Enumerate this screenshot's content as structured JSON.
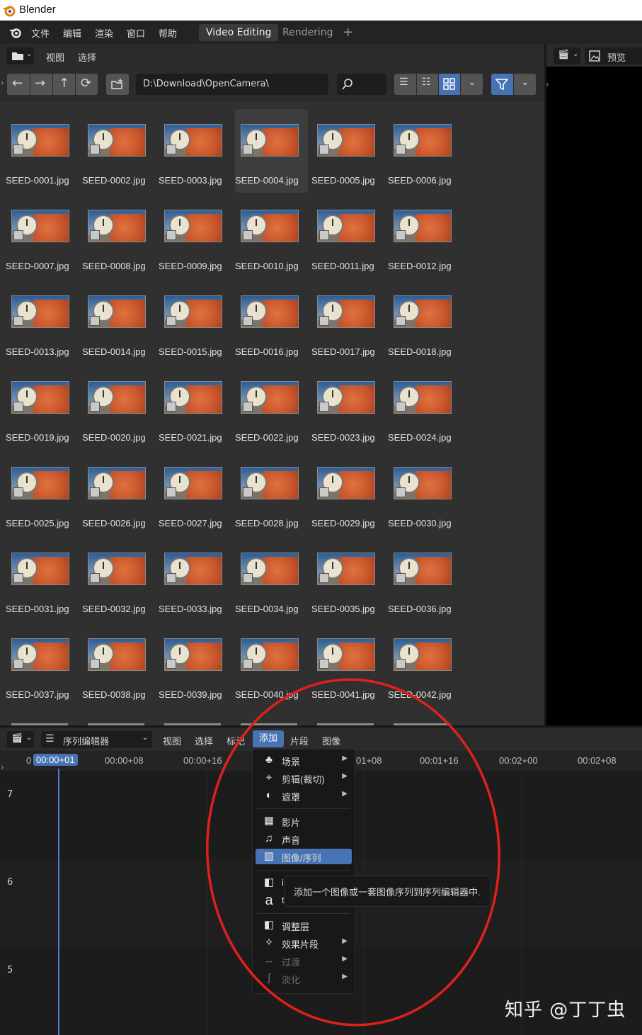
{
  "os_title": "Blender",
  "topbar": {
    "menus": [
      "文件",
      "编辑",
      "渲染",
      "窗口",
      "帮助"
    ],
    "workspaces": [
      "Video Editing",
      "Rendering"
    ],
    "add_workspace": "+"
  },
  "file_browser": {
    "header_menus": [
      "视图",
      "选择"
    ],
    "path": "D:\\Download\\OpenCamera\\",
    "files": [
      "SEED-0001.jpg",
      "SEED-0002.jpg",
      "SEED-0003.jpg",
      "SEED-0004.jpg",
      "SEED-0005.jpg",
      "SEED-0006.jpg",
      "SEED-0007.jpg",
      "SEED-0008.jpg",
      "SEED-0009.jpg",
      "SEED-0010.jpg",
      "SEED-0011.jpg",
      "SEED-0012.jpg",
      "SEED-0013.jpg",
      "SEED-0014.jpg",
      "SEED-0015.jpg",
      "SEED-0016.jpg",
      "SEED-0017.jpg",
      "SEED-0018.jpg",
      "SEED-0019.jpg",
      "SEED-0020.jpg",
      "SEED-0021.jpg",
      "SEED-0022.jpg",
      "SEED-0023.jpg",
      "SEED-0024.jpg",
      "SEED-0025.jpg",
      "SEED-0026.jpg",
      "SEED-0027.jpg",
      "SEED-0028.jpg",
      "SEED-0029.jpg",
      "SEED-0030.jpg",
      "SEED-0031.jpg",
      "SEED-0032.jpg",
      "SEED-0033.jpg",
      "SEED-0034.jpg",
      "SEED-0035.jpg",
      "SEED-0036.jpg",
      "SEED-0037.jpg",
      "SEED-0038.jpg",
      "SEED-0039.jpg",
      "SEED-0040.jpg",
      "SEED-0041.jpg",
      "SEED-0042.jpg"
    ],
    "selected_file": "SEED-0004.jpg"
  },
  "preview": {
    "label": "预览"
  },
  "sequencer": {
    "editor_type": "序列编辑器",
    "header_menus": [
      "视图",
      "选择",
      "标记",
      "添加",
      "片段",
      "图像"
    ],
    "active_menu": "添加",
    "current_time": "00:00+01",
    "ruler_ticks": [
      "0",
      "00:00+08",
      "00:00+16",
      "01+08",
      "00:01+16",
      "00:02+00",
      "00:02+08"
    ],
    "channels": [
      "7",
      "6",
      "5"
    ]
  },
  "add_menu": {
    "items": [
      {
        "label": "场景",
        "icon": "scene-icon",
        "submenu": true
      },
      {
        "label": "剪辑(裁切)",
        "icon": "clip-icon",
        "submenu": true
      },
      {
        "label": "遮罩",
        "icon": "mask-icon",
        "submenu": true
      },
      {
        "label": "影片",
        "icon": "movie-icon",
        "submenu": false
      },
      {
        "label": "声音",
        "icon": "sound-icon",
        "submenu": false
      },
      {
        "label": "图像/序列",
        "icon": "image-icon",
        "submenu": false,
        "highlighted": true
      },
      {
        "label": "i",
        "icon": "color-icon",
        "submenu": false
      },
      {
        "label": "t",
        "icon": "text-icon",
        "submenu": false
      },
      {
        "label": "调整层",
        "icon": "adjustment-icon",
        "submenu": false
      },
      {
        "label": "效果片段",
        "icon": "effect-icon",
        "submenu": true
      },
      {
        "label": "过渡",
        "icon": "transition-icon",
        "submenu": true,
        "disabled": true
      },
      {
        "label": "淡化",
        "icon": "fade-icon",
        "submenu": true,
        "disabled": true
      }
    ]
  },
  "tooltip": "添加一个图像或一套图像序列到序列编辑器中.",
  "watermark": "知乎 @丁丁虫",
  "colors": {
    "accent": "#4772b3",
    "annotation_circle": "#e0201b"
  }
}
